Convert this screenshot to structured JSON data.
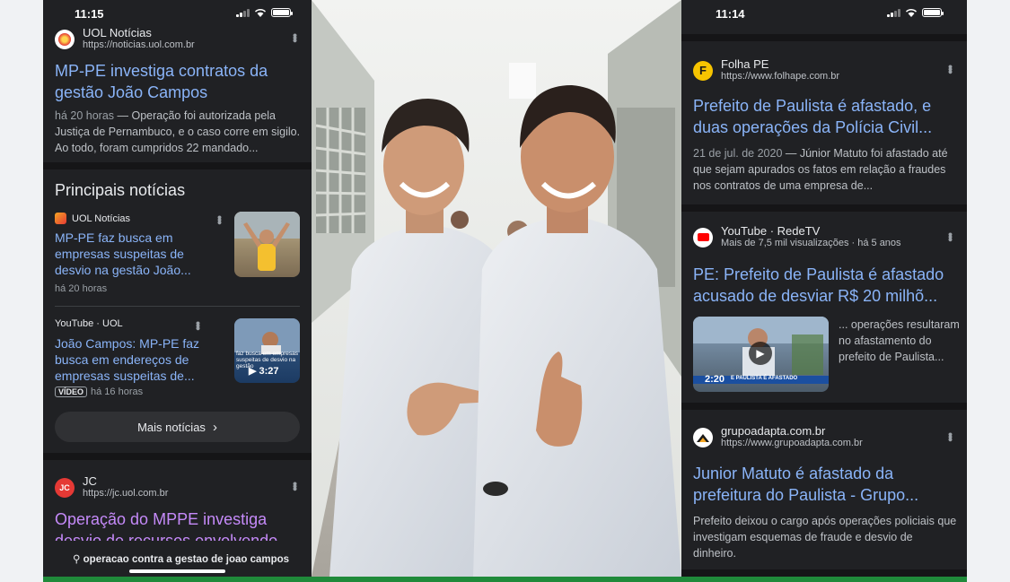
{
  "left": {
    "time": "11:15",
    "top_result": {
      "source": "UOL Notícias",
      "url": "https://noticias.uol.com.br",
      "title": "MP-PE investiga contratos da gestão João Campos",
      "date": "há 20 horas",
      "snippet": "— Operação foi autorizada pela Justiça de Pernambuco, e o caso corre em sigilo. Ao todo, foram cumpridos 22 mandado..."
    },
    "top_stories": {
      "heading": "Principais notícias",
      "items": [
        {
          "source": "UOL Notícias",
          "title": "MP-PE faz busca em empresas suspeitas de desvio na gestão João...",
          "time": "há 20 horas"
        },
        {
          "source": "YouTube · UOL",
          "title": "João Campos: MP-PE faz busca em endereços de empresas suspeitas de...",
          "badge": "VÍDEO",
          "time": "há 16 horas",
          "duration": "3:27",
          "thumb_text": "faz busca em empresas suspeitas de desvio na gestão"
        }
      ],
      "more_label": "Mais notícias",
      "more_arrow": "›"
    },
    "jc_result": {
      "source": "JC",
      "url": "https://jc.uol.com.br",
      "title": "Operação do MPPE investiga desvio de recursos envolvendo ..."
    },
    "search_query": "operacao contra a gestao de joao campos"
  },
  "right": {
    "time": "11:14",
    "results": [
      {
        "source": "Folha PE",
        "url": "https://www.folhape.com.br",
        "title": "Prefeito de Paulista é afastado, e duas operações da Polícia Civil...",
        "date": "21 de jul. de 2020",
        "snippet": "— Júnior Matuto foi afastado até que sejam apurados os fatos em relação a fraudes nos contratos de uma empresa de..."
      },
      {
        "source": "YouTube · RedeTV",
        "url": "Mais de 7,5 mil visualizações · há 5 anos",
        "title": "PE: Prefeito de Paulista é afastado acusado de desviar R$ 20 milhõ...",
        "snippet": "... operações resultaram no afastamento do prefeito de Paulista...",
        "duration": "2:20",
        "thumb_text": "E PAULISTA É AFASTADO"
      },
      {
        "source": "grupoadapta.com.br",
        "url": "https://www.grupoadapta.com.br",
        "title": "Junior Matuto é afastado da prefeitura do Paulista - Grupo...",
        "snippet": "Prefeito deixou o cargo após operações policiais que investigam esquemas de fraude e desvio de dinheiro."
      }
    ]
  },
  "colors": {
    "link": "#8ab4f8",
    "visited": "#c58af9",
    "bg": "#202124",
    "green": "#1f8a3a"
  }
}
